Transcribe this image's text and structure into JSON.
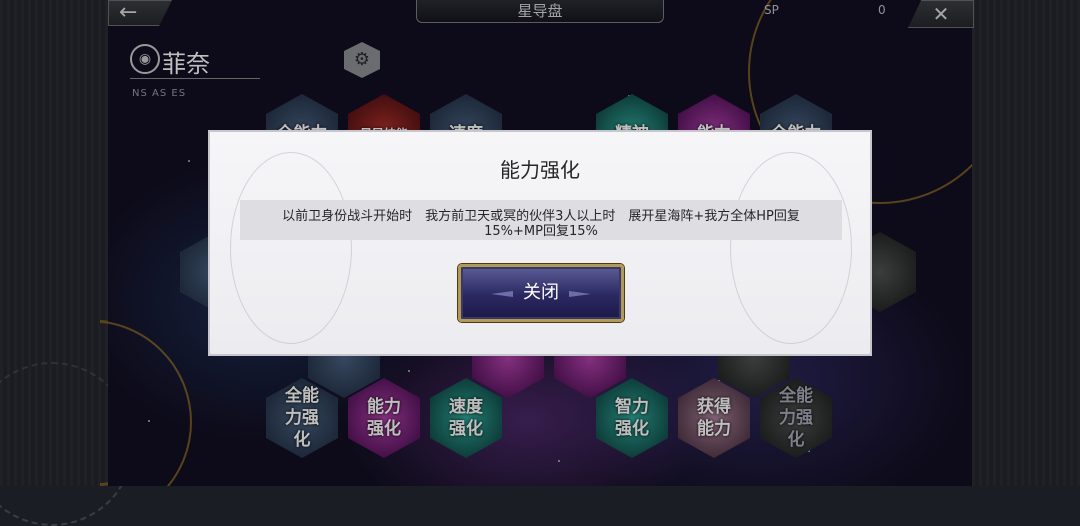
{
  "header": {
    "back_icon": "←",
    "title": "星导盘",
    "sp_label": "SP",
    "sp_value": "0",
    "close_icon": "✕"
  },
  "character": {
    "name": "菲奈",
    "tags": "NS  AS  ES"
  },
  "nodes": [
    {
      "text": "全能力",
      "color": "blue"
    },
    {
      "text": "星导技能",
      "color": "gold"
    },
    {
      "text": "速度",
      "color": "blue"
    },
    {
      "text": "精神",
      "color": "teal"
    },
    {
      "text": "能力",
      "color": "purple"
    },
    {
      "text": "全能力",
      "color": "blue"
    },
    {
      "text": "全能力强化",
      "color": "blue"
    },
    {
      "text": "能力强化",
      "color": "purple"
    },
    {
      "text": "速度强化",
      "color": "teal"
    },
    {
      "text": "智力强化",
      "color": "teal"
    },
    {
      "text": "获得能力",
      "color": "pink"
    },
    {
      "text": "全能力强化",
      "color": "dark"
    }
  ],
  "dialog": {
    "title": "能力强化",
    "description": "以前卫身份战斗开始时　我方前卫天或冥的伙伴3人以上时　展开星海阵+我方全体HP回复15%+MP回复15%",
    "close_button": "关闭"
  }
}
